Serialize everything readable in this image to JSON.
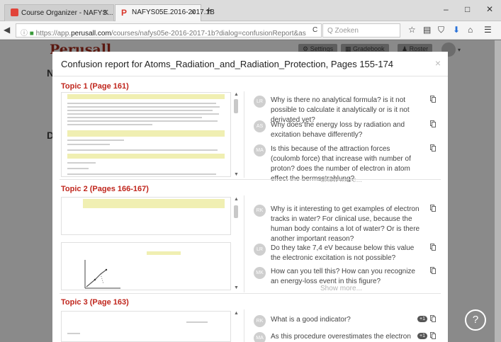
{
  "browser": {
    "tabs": [
      {
        "label": "Course Organizer - NAFYS..."
      },
      {
        "label": "NAFYS05E.2016-2017.1B"
      }
    ],
    "new_tab": "+",
    "window_controls": {
      "minimize": "–",
      "maximize": "□",
      "close": "✕"
    },
    "url_prefix": "https://app.",
    "url_domain": "perusall.com",
    "url_suffix": "/courses/nafys05e-2016-2017-1b?dialog=confusionReport&as",
    "search_placeholder": "Q  Zoeken",
    "reload_label": "C"
  },
  "app": {
    "logo": "Perusall",
    "buttons": {
      "settings": "Settings",
      "gradebook": "Gradebook",
      "roster": "Roster"
    },
    "side_letters": [
      "N",
      "D"
    ]
  },
  "modal": {
    "title": "Confusion report for Atoms_Radiation_and_Radiation_Protection, Pages 155-174",
    "close": "×"
  },
  "topics": [
    {
      "title": "Topic 1 (Page 161)",
      "comments": [
        {
          "initials": "LR",
          "text": "Why is there no analytical formula? is it not possible to calculate it analytically or is it not derivated yet?"
        },
        {
          "initials": "AS",
          "text": "Why does the energy loss by radiation and excitation behave differently?"
        },
        {
          "initials": "MA",
          "text": "Is this because of the attraction forces (coulomb force) that increase with number of proton? does the number of electron in atom effect the bermsstrahlung?"
        }
      ],
      "show_more": "Show more..."
    },
    {
      "title": "Topic 2 (Pages 166-167)",
      "comments": [
        {
          "initials": "RK",
          "text": "Why is it interesting to get examples of electron tracks in water? For clinical use, because the human body contains a lot of water? Or is there another important reason?"
        },
        {
          "initials": "LR",
          "text": "Do they take 7,4 eV because below this value the electronic excitation is not possible?"
        },
        {
          "initials": "MK",
          "text": "How can you tell this? How can you recognize an energy-loss event in this figure?"
        }
      ],
      "show_more": "Show more..."
    },
    {
      "title": "Topic 3 (Page 163)",
      "comments": [
        {
          "initials": "RK",
          "text": "What is a good indicator?",
          "badge": "+1"
        },
        {
          "initials": "MA",
          "text": "As this procedure overestimates the electron",
          "badge": "+1"
        }
      ]
    }
  ],
  "help": "?",
  "colors": {
    "accent": "#c0261d",
    "logo": "#5a1810",
    "highlight": "#f0efb2",
    "overlay": "#7b7b7b"
  }
}
